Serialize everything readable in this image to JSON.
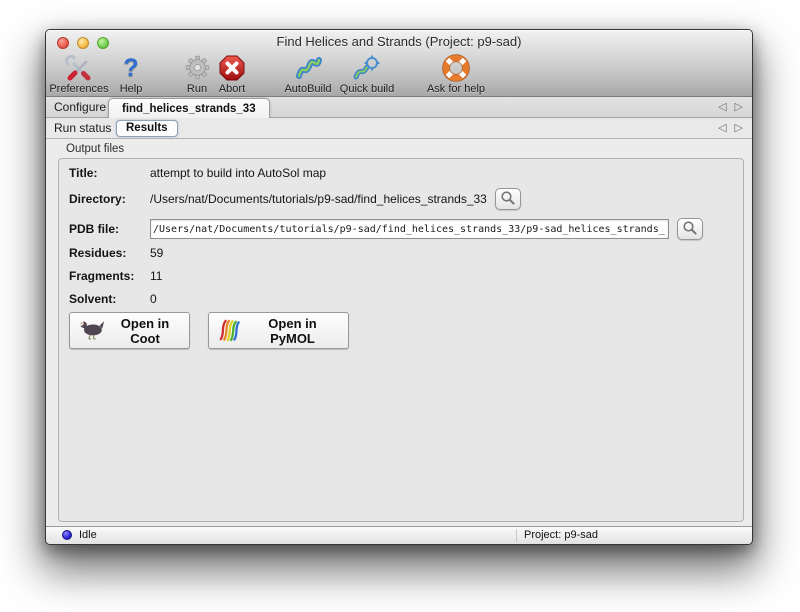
{
  "window": {
    "title": "Find Helices and Strands (Project: p9-sad)"
  },
  "toolbar": {
    "items": [
      {
        "label": "Preferences",
        "icon": "tools-icon"
      },
      {
        "label": "Help",
        "icon": "question-icon"
      },
      {
        "label": "Run",
        "icon": "gear-icon"
      },
      {
        "label": "Abort",
        "icon": "abort-icon"
      },
      {
        "label": "AutoBuild",
        "icon": "autobuild-icon"
      },
      {
        "label": "Quick build",
        "icon": "quickbuild-icon"
      },
      {
        "label": "Ask for help",
        "icon": "lifebuoy-icon"
      }
    ]
  },
  "tabs": {
    "row1": [
      {
        "label": "Configure",
        "active": false
      },
      {
        "label": "find_helices_strands_33",
        "active": true
      }
    ],
    "row2": [
      {
        "label": "Run status",
        "active": false
      },
      {
        "label": "Results",
        "active": true
      }
    ]
  },
  "nav": {
    "back": "◁",
    "forward": "▷"
  },
  "output_files": {
    "section_label": "Output files",
    "title": {
      "label": "Title:",
      "value": "attempt to build into AutoSol map"
    },
    "directory": {
      "label": "Directory:",
      "value": "/Users/nat/Documents/tutorials/p9-sad/find_helices_strands_33"
    },
    "pdb": {
      "label": "PDB file:",
      "value": "/Users/nat/Documents/tutorials/p9-sad/find_helices_strands_33/p9-sad_helices_strands_"
    },
    "residues": {
      "label": "Residues:",
      "value": "59"
    },
    "fragments": {
      "label": "Fragments:",
      "value": "11"
    },
    "solvent": {
      "label": "Solvent:",
      "value": "0"
    },
    "buttons": {
      "coot": "Open in Coot",
      "pymol": "Open in PyMOL"
    }
  },
  "statusbar": {
    "status": "Idle",
    "project": "Project: p9-sad"
  },
  "colors": {
    "close_button": "#ee6156",
    "minimize_button": "#f6bf4f",
    "zoom_button": "#78d25b",
    "help_icon": "#2e6ed0",
    "abort_icon": "#c81e1e",
    "lifebuoy_icon": "#e87a2c",
    "status_dot": "#2a24d8"
  }
}
